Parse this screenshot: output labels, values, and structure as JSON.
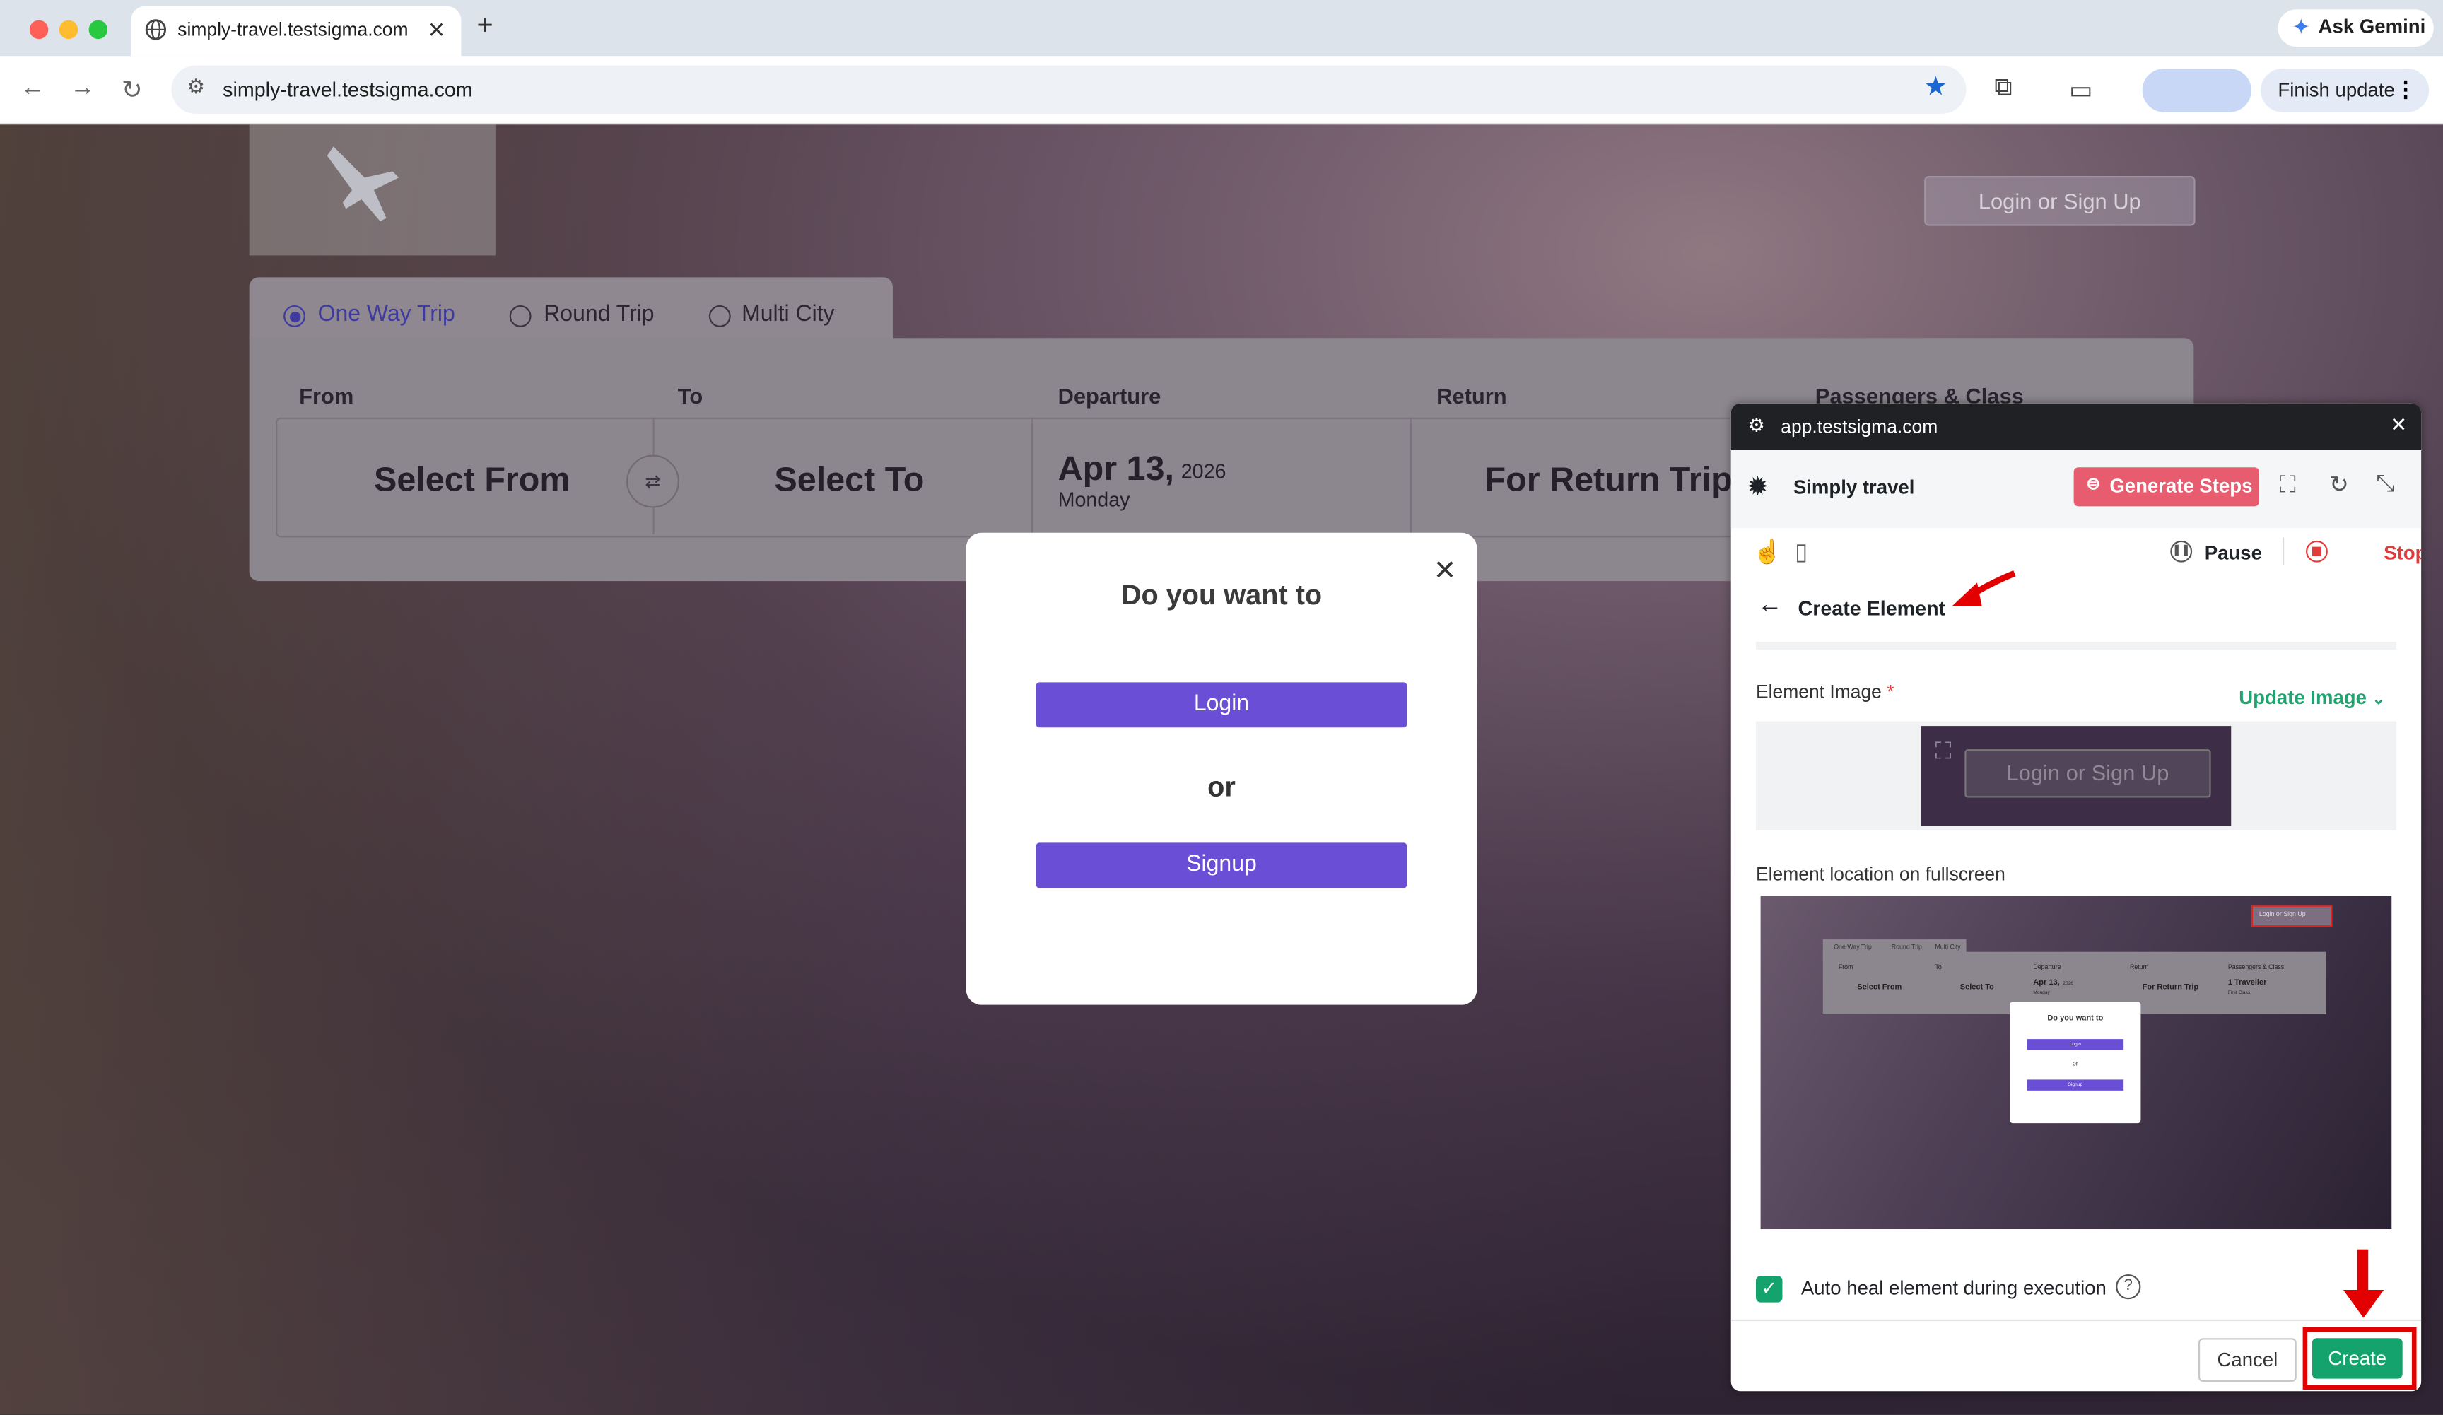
{
  "browser": {
    "tab_title": "simply-travel.testsigma.com",
    "url": "simply-travel.testsigma.com",
    "ask_gemini": "Ask Gemini",
    "finish_update": "Finish update"
  },
  "site": {
    "login_signup": "Login or Sign Up",
    "trip_types": [
      {
        "label": "One Way Trip",
        "selected": true
      },
      {
        "label": "Round Trip",
        "selected": false
      },
      {
        "label": "Multi City",
        "selected": false
      }
    ],
    "fields": {
      "from_label": "From",
      "to_label": "To",
      "departure_label": "Departure",
      "return_label": "Return",
      "passengers_label": "Passengers & Class",
      "from_value": "Select From",
      "to_value": "Select To",
      "departure_date": "Apr 13,",
      "departure_year": "2026",
      "departure_day": "Monday",
      "return_value": "For Return Trip"
    }
  },
  "modal": {
    "title": "Do you want to",
    "login": "Login",
    "or": "or",
    "signup": "Signup"
  },
  "panel": {
    "domain": "app.testsigma.com",
    "project": "Simply travel",
    "generate_steps": "Generate Steps",
    "pause": "Pause",
    "stop": "Stop",
    "title": "Create Element",
    "element_image_label": "Element Image",
    "required_mark": "*",
    "update_image": "Update Image",
    "element_location_label": "Element location on fullscreen",
    "auto_heal": "Auto heal element during execution",
    "auto_heal_checked": true,
    "cancel": "Cancel",
    "create": "Create",
    "thumb_text": {
      "title": "Do you want to",
      "login": "Login",
      "or": "or",
      "signup": "Signup",
      "trip_types": [
        "One Way Trip",
        "Round Trip",
        "Multi City"
      ],
      "labels": [
        "From",
        "To",
        "Departure",
        "Return",
        "Passengers & Class"
      ],
      "from": "Select From",
      "to": "Select To",
      "date": "Apr 13,",
      "year": "2026",
      "day": "Monday",
      "return": "For Return Trip",
      "traveller": "1 Traveller",
      "class": "First Class",
      "login_signup": "Login or Sign Up"
    }
  },
  "colors": {
    "accent_purple": "#6a4fd6",
    "testsigma_green": "#14a36c",
    "generate_red": "#e85c6f",
    "highlight_red": "#e30000"
  }
}
